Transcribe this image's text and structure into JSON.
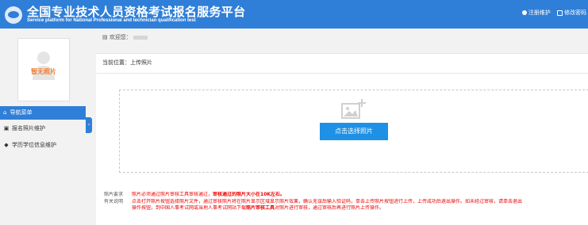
{
  "header": {
    "title": "全国专业技术人员资格考试报名服务平台",
    "subtitle": "Service platform for National Professional and technician qualification test",
    "links": [
      {
        "label": "注册维护",
        "icon": "info-circle-icon"
      },
      {
        "label": "修改密码",
        "icon": "edit-icon"
      }
    ],
    "color": "#2f7fd8"
  },
  "sidebar": {
    "photo_placeholder": "暂无照片",
    "nav_title": "导航菜单",
    "items": [
      {
        "label": "报名照片维护",
        "icon": "image-icon"
      },
      {
        "label": "学历学位信息维护",
        "icon": "graduation-cap-icon"
      }
    ]
  },
  "main": {
    "welcome": "欢迎您：",
    "breadcrumb": "当前位置：上传照片",
    "upload_button": "点击选择照片",
    "req_label_1": "照片要求",
    "req_text_1a": "照片必须通过照片审核工具审核通过，",
    "req_text_1b": "审核通过的照片大小在10K左右。",
    "req_label_2": "有关说明",
    "req_text_2": "点击打开照片按钮选择照片文件，通过审核照片将在照片显示区域显示照片效果，确认无误后输入验证码，单击上传照片按钮进行上传，上传成功后退出操作。如未经过审核，请单击退出",
    "req_text_3a": "操作按钮，到中国人事考试网或当地人事考试网站下载",
    "req_text_3b": "照片审核工具",
    "req_text_3c": "对照片进行审核，通过审核后再进行照片上传操作。"
  }
}
